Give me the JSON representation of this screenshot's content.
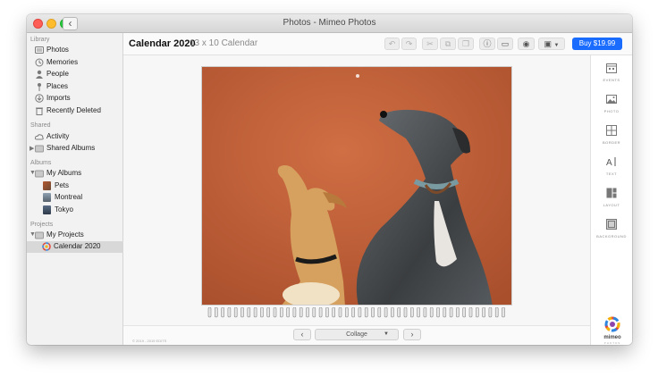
{
  "window": {
    "title": "Photos - Mimeo Photos"
  },
  "sidebar": {
    "sections": [
      {
        "header": "Library",
        "items": [
          {
            "label": "Photos",
            "icon": "photos-icon"
          },
          {
            "label": "Memories",
            "icon": "memories-icon"
          },
          {
            "label": "People",
            "icon": "people-icon"
          },
          {
            "label": "Places",
            "icon": "places-icon"
          },
          {
            "label": "Imports",
            "icon": "imports-icon"
          },
          {
            "label": "Recently Deleted",
            "icon": "trash-icon"
          }
        ]
      },
      {
        "header": "Shared",
        "items": [
          {
            "label": "Activity",
            "icon": "cloud-icon"
          },
          {
            "label": "Shared Albums",
            "icon": "folder-icon"
          }
        ]
      },
      {
        "header": "Albums",
        "items": [
          {
            "label": "My Albums",
            "icon": "folder-icon"
          },
          {
            "label": "Pets",
            "icon": "album-thumb"
          },
          {
            "label": "Montreal",
            "icon": "album-thumb"
          },
          {
            "label": "Tokyo",
            "icon": "album-thumb"
          }
        ]
      },
      {
        "header": "Projects",
        "items": [
          {
            "label": "My Projects",
            "icon": "folder-icon"
          },
          {
            "label": "Calendar 2020",
            "icon": "mimeo-project-icon",
            "selected": true
          }
        ]
      }
    ]
  },
  "toolbar": {
    "title": "Calendar 2020",
    "subtitle": "13 x 10 Calendar",
    "buy_label": "Buy $19.99",
    "buy_color": "#1a6cff"
  },
  "right_panel": {
    "tools": [
      {
        "label": "EVENTS",
        "icon": "events-icon"
      },
      {
        "label": "PHOTO",
        "icon": "photo-icon"
      },
      {
        "label": "BORDER",
        "icon": "border-icon"
      },
      {
        "label": "TEXT",
        "icon": "text-icon"
      },
      {
        "label": "LAYOUT",
        "icon": "layout-icon"
      },
      {
        "label": "BACKGROUND",
        "icon": "background-icon"
      }
    ],
    "brand": {
      "name": "mimeo",
      "sub": "PHOTOS"
    }
  },
  "bottom": {
    "layout_value": "Collage",
    "copyright": "© 2019 - 2019 EDITS"
  },
  "colors": {
    "photo_background": "#c4623a",
    "accent": "#1a6cff"
  }
}
